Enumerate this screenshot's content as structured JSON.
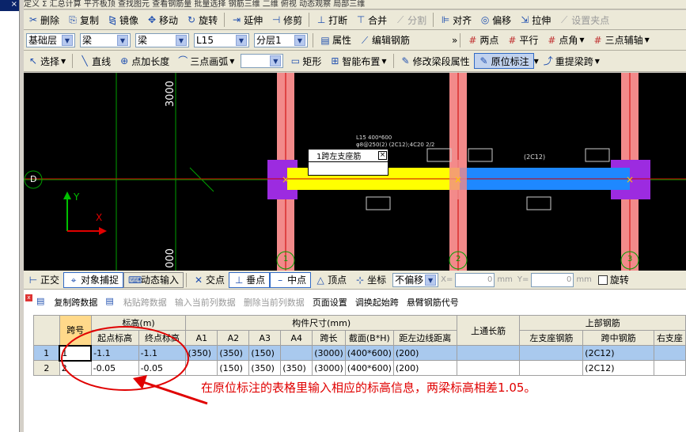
{
  "top_partial": "定义  Σ 汇总计算  平齐板顶  查找图元  查看钢筋量  批量选择  钢筋三维  二维  俯视  动态观察  局部三维",
  "toolbar1": [
    {
      "icon": "delete-icon",
      "glyph": "✂",
      "label": "删除",
      "enabled": true
    },
    {
      "icon": "copy-icon",
      "glyph": "⎘",
      "label": "复制",
      "enabled": true
    },
    {
      "icon": "mirror-icon",
      "glyph": "⧎",
      "label": "镜像",
      "enabled": true
    },
    {
      "icon": "move-icon",
      "glyph": "✥",
      "label": "移动",
      "enabled": true
    },
    {
      "icon": "rotate-icon",
      "glyph": "↻",
      "label": "旋转",
      "enabled": true
    },
    {
      "icon": "extend-icon",
      "glyph": "⇥",
      "label": "延伸",
      "enabled": true
    },
    {
      "icon": "trim-icon",
      "glyph": "⊣",
      "label": "修剪",
      "enabled": true
    },
    {
      "icon": "break-icon",
      "glyph": "⊥",
      "label": "打断",
      "enabled": true
    },
    {
      "icon": "merge-icon",
      "glyph": "⊤",
      "label": "合并",
      "enabled": true
    },
    {
      "icon": "split-icon",
      "glyph": "⟋",
      "label": "分割",
      "enabled": false
    },
    {
      "icon": "align-icon",
      "glyph": "⊫",
      "label": "对齐",
      "enabled": true
    },
    {
      "icon": "offset-icon",
      "glyph": "◎",
      "label": "偏移",
      "enabled": true
    },
    {
      "icon": "stretch-icon",
      "glyph": "⇲",
      "label": "拉伸",
      "enabled": true
    },
    {
      "icon": "grip-icon",
      "glyph": "⟋",
      "label": "设置夹点",
      "enabled": false
    }
  ],
  "toolbar2": {
    "floor_type": "基础层",
    "element_type": "梁",
    "element_sub": "梁",
    "element_name": "L15",
    "layer": "分层1",
    "property_label": "属性",
    "edit_rebar_label": "编辑钢筋",
    "more": "»",
    "two_point_label": "两点",
    "parallel_label": "平行",
    "point_angle_label": "点角",
    "three_point_aux_label": "三点辅轴"
  },
  "toolbar3": {
    "select_label": "选择",
    "line_label": "直线",
    "point_length_label": "点加长度",
    "arc_label": "三点画弧",
    "rect_label": "矩形",
    "smart_label": "智能布置",
    "modify_span_label": "修改梁段属性",
    "in_situ_label": "原位标注",
    "relift_label": "重提梁跨"
  },
  "canvas": {
    "dim_top": "3000",
    "dim_bottom": "000",
    "axis_d": "D",
    "axis_y": "Y",
    "axis_x": "X",
    "grid_1": "1",
    "grid_2": "2",
    "grid_3": "3",
    "beam_label_1": "L15 400*600",
    "beam_label_2": "φ8@250(2) (2C12);4C20 2/2",
    "popup_text": "1跨左支座筋",
    "right_annot": "(2C12)"
  },
  "statusbar": {
    "ortho_label": "正交",
    "snap_label": "对象捕捉",
    "dyn_label": "动态输入",
    "intersect_label": "交点",
    "perp_label": "垂点",
    "mid_label": "中点",
    "vertex_label": "顶点",
    "coord_label": "坐标",
    "offset_mode": "不偏移",
    "x_label": "X=",
    "x_value": "0",
    "unit1": "mm",
    "y_label": "Y=",
    "y_value": "0",
    "unit2": "mm",
    "rotate_label": "旋转"
  },
  "panel_toolbar": [
    {
      "label": "复制跨数据",
      "enabled": true
    },
    {
      "label": "粘贴跨数据",
      "enabled": false
    },
    {
      "label": "输入当前列数据",
      "enabled": false
    },
    {
      "label": "删除当前列数据",
      "enabled": false
    },
    {
      "label": "页面设置",
      "enabled": true
    },
    {
      "label": "调换起始跨",
      "enabled": true
    },
    {
      "label": "悬臂钢筋代号",
      "enabled": true
    }
  ],
  "table": {
    "h_span": "跨号",
    "h_elev": "标高(m)",
    "h_dims": "构件尺寸(mm)",
    "h_top_through": "上通长筋",
    "h_top_rebar": "上部钢筋",
    "h_start": "起点标高",
    "h_end": "终点标高",
    "h_a1": "A1",
    "h_a2": "A2",
    "h_a3": "A3",
    "h_a4": "A4",
    "h_span_len": "跨长",
    "h_section": "截面(B*H)",
    "h_dist": "距左边线距离",
    "h_left": "左支座钢筋",
    "h_mid": "跨中钢筋",
    "h_right": "右支座",
    "rows": [
      {
        "n": "1",
        "span": "1",
        "start": "-1.1",
        "end": "-1.1",
        "a1": "(350)",
        "a2": "(350)",
        "a3": "(150)",
        "a4": "",
        "len": "(3000)",
        "sec": "(400*600)",
        "dist": "(200)",
        "through": "",
        "left": "",
        "mid": "(2C12)",
        "right": ""
      },
      {
        "n": "2",
        "span": "2",
        "start": "-0.05",
        "end": "-0.05",
        "a1": "",
        "a2": "(150)",
        "a3": "(350)",
        "a4": "(350)",
        "len": "(3000)",
        "sec": "(400*600)",
        "dist": "(200)",
        "through": "",
        "left": "",
        "mid": "(2C12)",
        "right": ""
      }
    ]
  },
  "annotation": "在原位标注的表格里输入相应的标高信息，两梁标高相差1.05。"
}
